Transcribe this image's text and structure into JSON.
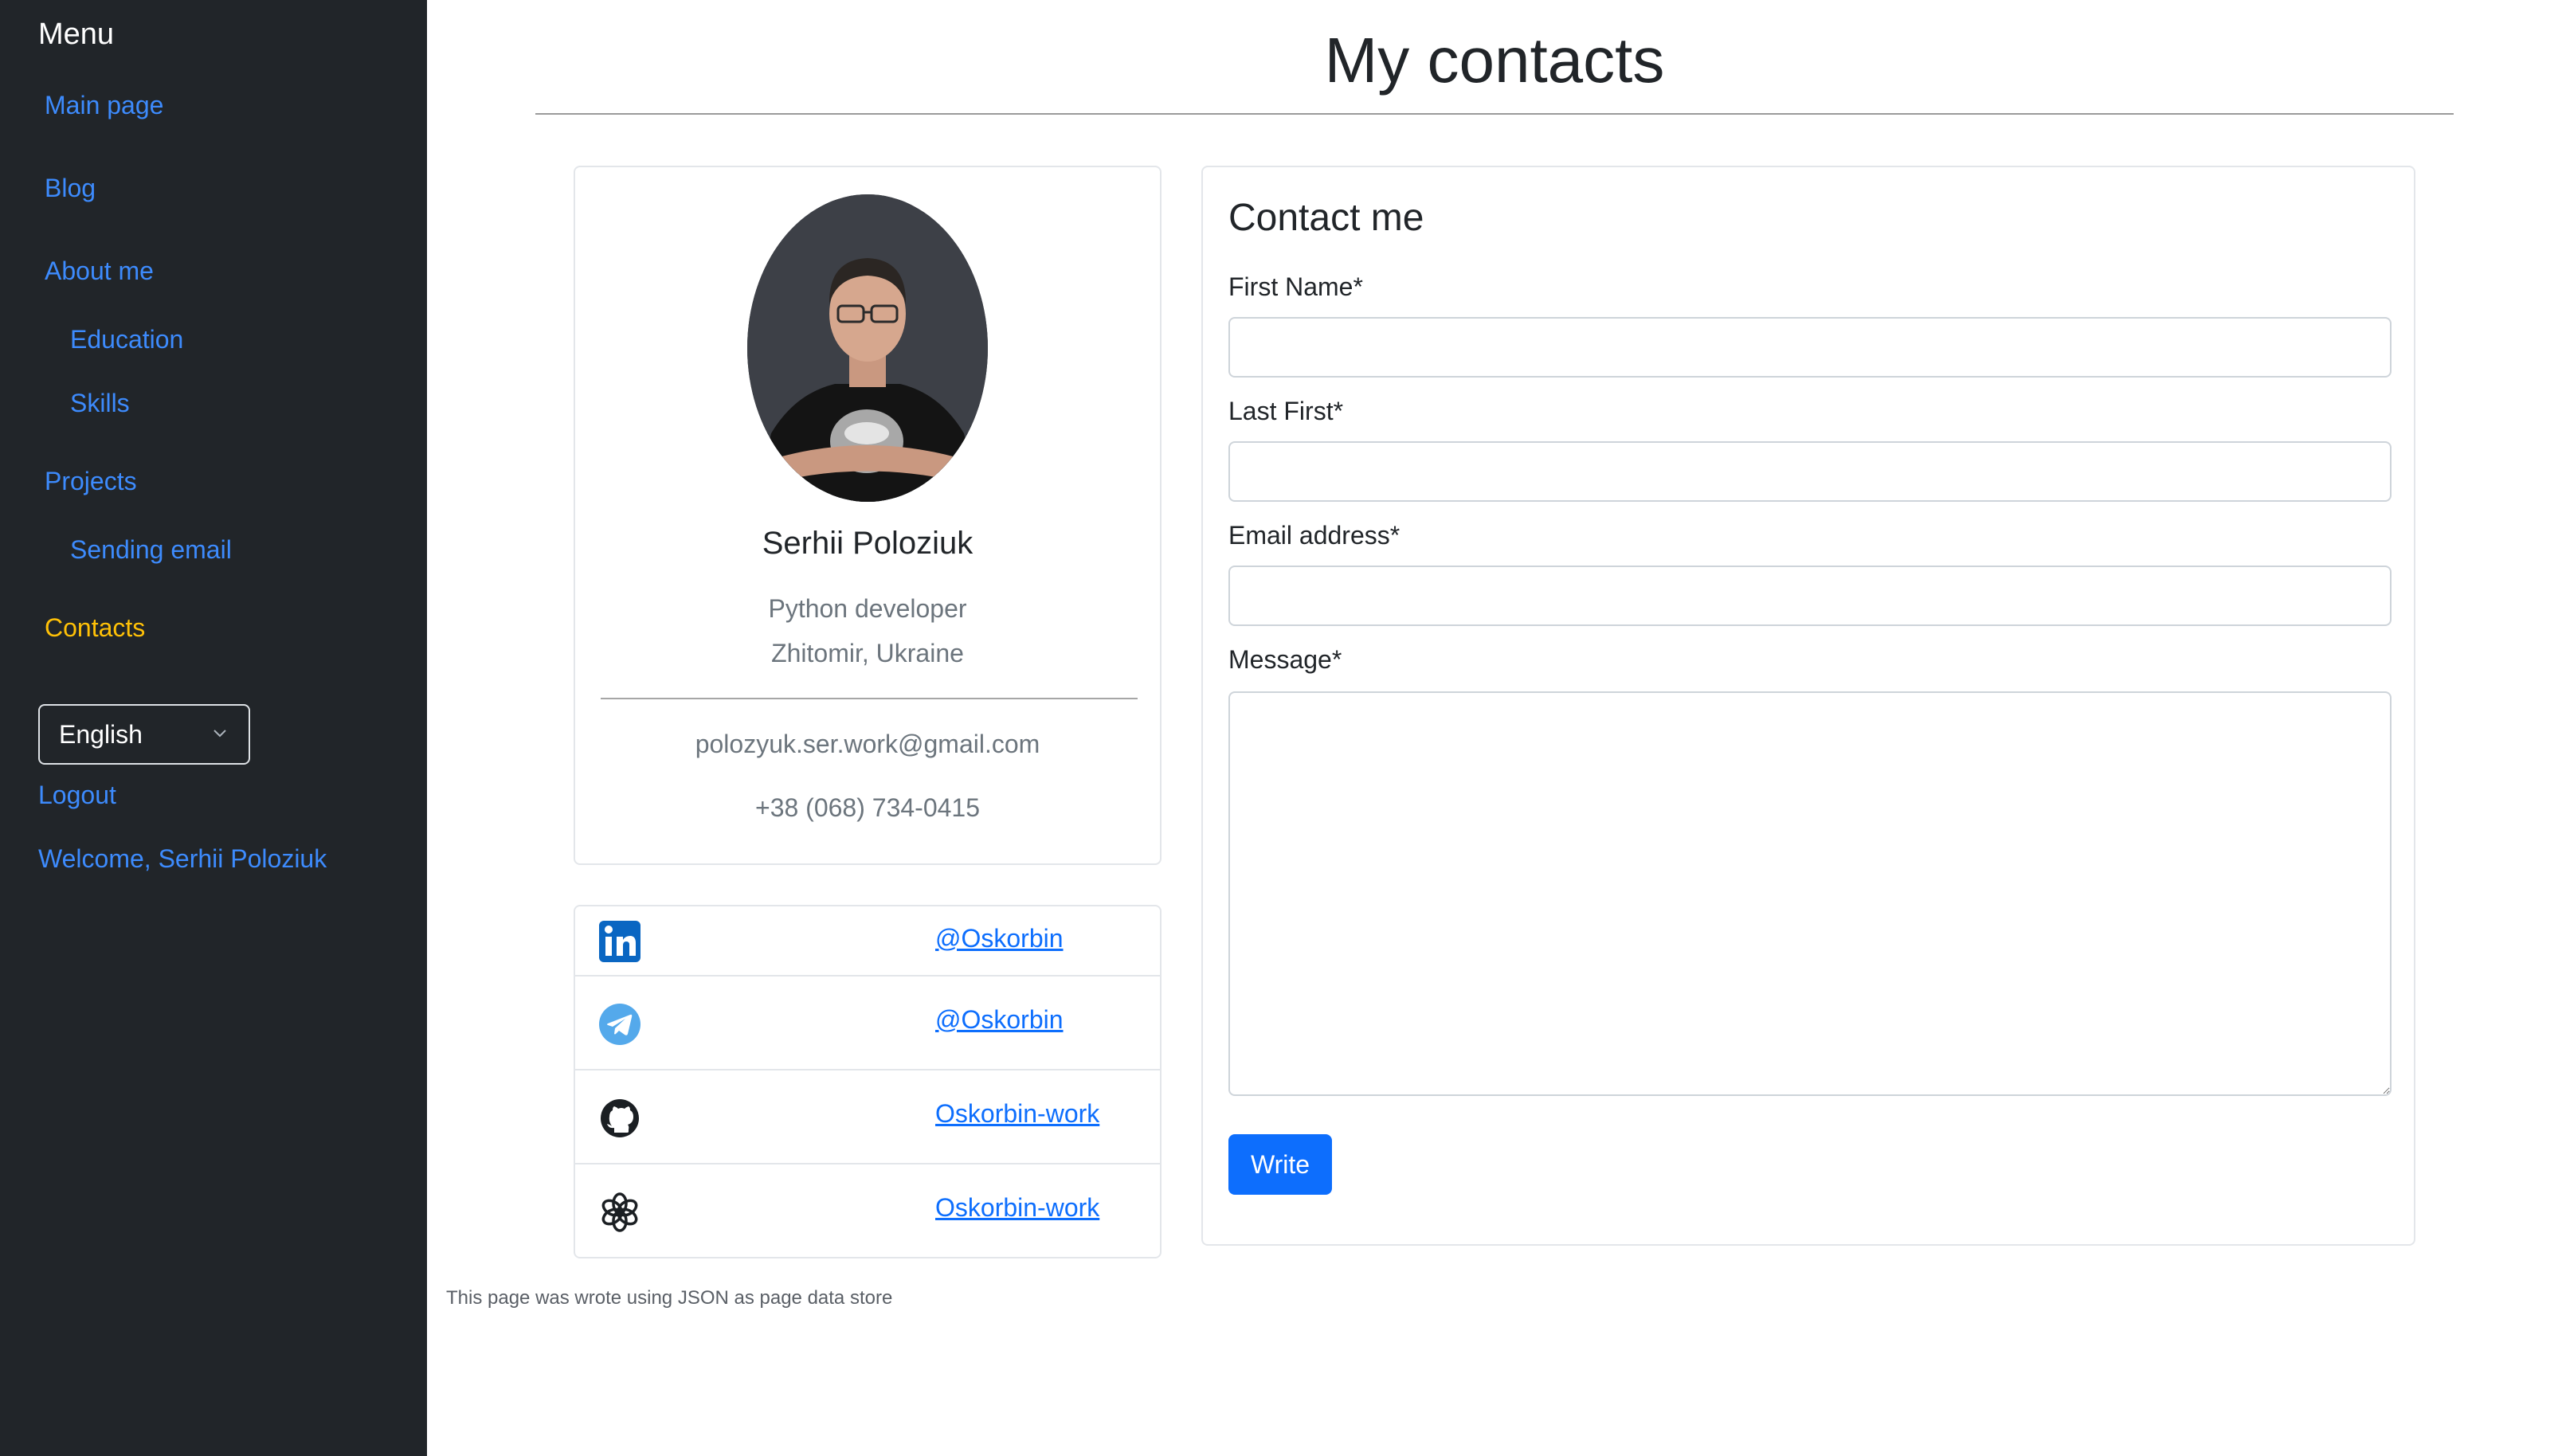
{
  "sidebar": {
    "title": "Menu",
    "items": [
      {
        "label": "Main page"
      },
      {
        "label": "Blog"
      },
      {
        "label": "About me"
      },
      {
        "label": "Education"
      },
      {
        "label": "Skills"
      },
      {
        "label": "Projects"
      },
      {
        "label": "Sending email"
      },
      {
        "label": "Contacts"
      }
    ],
    "active_item": "Contacts",
    "language": "English",
    "logout": "Logout",
    "welcome": "Welcome, Serhii Poloziuk"
  },
  "page": {
    "title": "My contacts",
    "footer": "This page was wrote using JSON as page data store"
  },
  "profile": {
    "name": "Serhii Poloziuk",
    "role": "Python developer",
    "location": "Zhitomir, Ukraine",
    "email": "polozyuk.ser.work@gmail.com",
    "phone": "+38 (068) 734-0415"
  },
  "socials": [
    {
      "icon": "linkedin-icon",
      "label": "@Oskorbin"
    },
    {
      "icon": "telegram-icon",
      "label": "@Oskorbin"
    },
    {
      "icon": "github-icon",
      "label": "Oskorbin-work"
    },
    {
      "icon": "openai-icon",
      "label": "Oskorbin-work"
    }
  ],
  "contact_form": {
    "title": "Contact me",
    "first_name_label": "First Name*",
    "last_name_label": "Last First*",
    "email_label": "Email address*",
    "message_label": "Message*",
    "first_name_value": "",
    "last_name_value": "",
    "email_value": "",
    "message_value": "",
    "submit_label": "Write"
  },
  "colors": {
    "sidebar_bg": "#212529",
    "link": "#3d8bfd",
    "active_link": "#ffc107",
    "primary": "#0d6efd",
    "linkedin": "#0a66c2",
    "telegram": "#54a9eb"
  }
}
